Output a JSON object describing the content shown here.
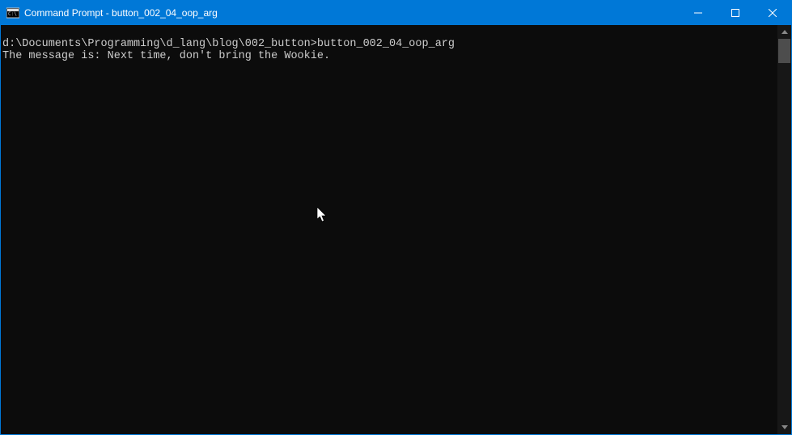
{
  "titlebar": {
    "title": "Command Prompt - button_002_04_oop_arg"
  },
  "terminal": {
    "prompt_path": "d:\\Documents\\Programming\\d_lang\\blog\\002_button>",
    "command": "button_002_04_oop_arg",
    "output_line": "The message is: Next time, don't bring the Wookie."
  }
}
